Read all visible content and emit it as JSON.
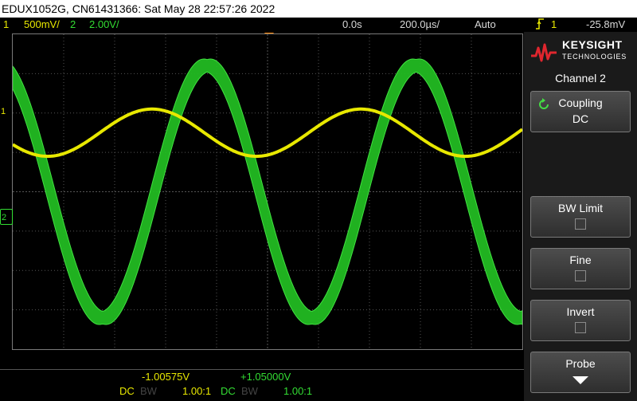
{
  "titlebar": {
    "text": "EDUX1052G, CN61431366: Sat May 28 22:57:26 2022"
  },
  "status": {
    "ch1_num": "1",
    "ch1_scale": "500mV/",
    "ch2_num": "2",
    "ch2_scale": "2.00V/",
    "time_pos": "0.0s",
    "time_scale": "200.0µs/",
    "trigger_mode": "Auto",
    "trigger_icon": "rising-edge-icon",
    "trigger_source": "1",
    "trigger_level": "-25.8mV"
  },
  "markers": {
    "ch1": "1",
    "ch2": "2"
  },
  "measurements": {
    "ch1_value": "-1.00575V",
    "ch2_value": "+1.05000V",
    "ch1_coupling": "DC",
    "ch1_bw": "BW",
    "ch1_probe": "1.00:1",
    "ch2_coupling": "DC",
    "ch2_bw": "BW",
    "ch2_probe": "1.00:1"
  },
  "panel": {
    "logo_name": "KEYSIGHT",
    "logo_sub": "TECHNOLOGIES",
    "title": "Channel 2",
    "softkeys": [
      {
        "label": "Coupling",
        "value": "DC",
        "icon": "rotate-icon"
      },
      {
        "label": "BW Limit",
        "checked": false
      },
      {
        "label": "Fine",
        "checked": false
      },
      {
        "label": "Invert",
        "checked": false
      },
      {
        "label": "Probe",
        "icon": "arrow-down-icon"
      }
    ]
  },
  "colors": {
    "ch1": "#e8e800",
    "ch2": "#33dd33",
    "trigger_marker": "#ff8800",
    "grid": "#555555"
  },
  "waveforms": {
    "ch1": {
      "type": "sine",
      "period_divisions": 4.1,
      "amplitude_divisions": 0.6,
      "offset_divisions": 1.5,
      "phase_deg": 210
    },
    "ch2": {
      "type": "sine",
      "period_divisions": 4.1,
      "amplitude_divisions": 3.2,
      "offset_divisions": 0,
      "phase_deg": 115,
      "band_divisions": 0.35
    }
  }
}
